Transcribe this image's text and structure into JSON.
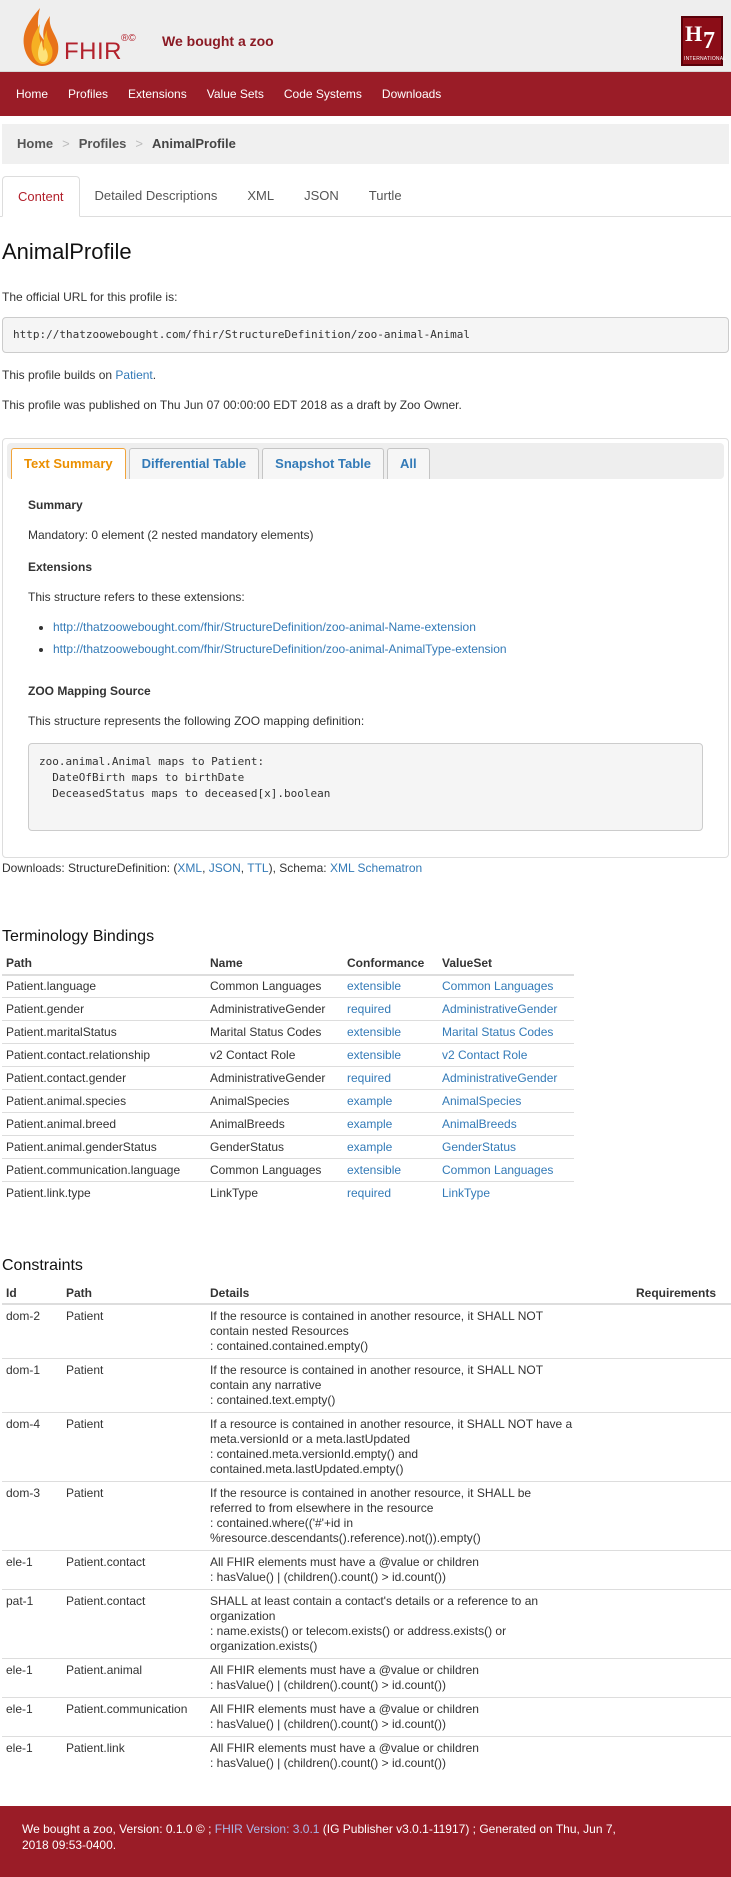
{
  "header": {
    "fhir_text": "FHIR",
    "fhir_mark": "®©",
    "site_title": "We bought a zoo",
    "hl7_letters_h": "H",
    "hl7_letters_7": "7",
    "hl7_intl": "INTERNATIONAL"
  },
  "nav": [
    "Home",
    "Profiles",
    "Extensions",
    "Value Sets",
    "Code Systems",
    "Downloads"
  ],
  "breadcrumb": {
    "home": "Home",
    "profiles": "Profiles",
    "current": "AnimalProfile",
    "separator": ">"
  },
  "top_tabs": [
    "Content",
    "Detailed Descriptions",
    "XML",
    "JSON",
    "Turtle"
  ],
  "content": {
    "title": "AnimalProfile",
    "url_intro": "The official URL for this profile is:",
    "url": "http://thatzoowebought.com/fhir/StructureDefinition/zoo-animal-Animal",
    "builds_on_pre": "This profile builds on ",
    "builds_on_link": "Patient",
    "builds_on_post": ".",
    "published": "This profile was published on Thu Jun 07 00:00:00 EDT 2018 as a draft by Zoo Owner."
  },
  "summary_tabs": [
    "Text Summary",
    "Differential Table",
    "Snapshot Table",
    "All"
  ],
  "summary": {
    "summary_heading": "Summary",
    "mandatory": "Mandatory: 0 element (2 nested mandatory elements)",
    "extensions_heading": "Extensions",
    "extensions_intro": "This structure refers to these extensions:",
    "extensions": [
      "http://thatzoowebought.com/fhir/StructureDefinition/zoo-animal-Name-extension",
      "http://thatzoowebought.com/fhir/StructureDefinition/zoo-animal-AnimalType-extension"
    ],
    "mapping_heading": "ZOO Mapping Source",
    "mapping_intro": "This structure represents the following ZOO mapping definition:",
    "mapping_code": "zoo.animal.Animal maps to Patient:\n  DateOfBirth maps to birthDate\n  DeceasedStatus maps to deceased[x].boolean"
  },
  "downloads": {
    "prefix": "Downloads: StructureDefinition: (",
    "xml": "XML",
    "sep1": ", ",
    "json": "JSON",
    "sep2": ", ",
    "ttl": "TTL",
    "mid": "), Schema: ",
    "schematron": "XML Schematron"
  },
  "terminology": {
    "heading": "Terminology Bindings",
    "columns": [
      "Path",
      "Name",
      "Conformance",
      "ValueSet"
    ],
    "rows": [
      [
        "Patient.language",
        "Common Languages",
        "extensible",
        "Common Languages"
      ],
      [
        "Patient.gender",
        "AdministrativeGender",
        "required",
        "AdministrativeGender"
      ],
      [
        "Patient.maritalStatus",
        "Marital Status Codes",
        "extensible",
        "Marital Status Codes"
      ],
      [
        "Patient.contact.relationship",
        "v2 Contact Role",
        "extensible",
        "v2 Contact Role"
      ],
      [
        "Patient.contact.gender",
        "AdministrativeGender",
        "required",
        "AdministrativeGender"
      ],
      [
        "Patient.animal.species",
        "AnimalSpecies",
        "example",
        "AnimalSpecies"
      ],
      [
        "Patient.animal.breed",
        "AnimalBreeds",
        "example",
        "AnimalBreeds"
      ],
      [
        "Patient.animal.genderStatus",
        "GenderStatus",
        "example",
        "GenderStatus"
      ],
      [
        "Patient.communication.language",
        "Common Languages",
        "extensible",
        "Common Languages"
      ],
      [
        "Patient.link.type",
        "LinkType",
        "required",
        "LinkType"
      ]
    ]
  },
  "constraints": {
    "heading": "Constraints",
    "columns": [
      "Id",
      "Path",
      "Details",
      "Requirements"
    ],
    "rows": [
      {
        "id": "dom-2",
        "path": "Patient",
        "details": [
          "If the resource is contained in another resource, it SHALL NOT",
          "contain nested Resources",
          ": contained.contained.empty()"
        ],
        "req": ""
      },
      {
        "id": "dom-1",
        "path": "Patient",
        "details": [
          "If the resource is contained in another resource, it SHALL NOT",
          "contain any narrative",
          ": contained.text.empty()"
        ],
        "req": ""
      },
      {
        "id": "dom-4",
        "path": "Patient",
        "details": [
          "If a resource is contained in another resource, it SHALL NOT have a",
          "meta.versionId or a meta.lastUpdated",
          ": contained.meta.versionId.empty() and",
          "contained.meta.lastUpdated.empty()"
        ],
        "req": ""
      },
      {
        "id": "dom-3",
        "path": "Patient",
        "details": [
          "If the resource is contained in another resource, it SHALL be",
          "referred to from elsewhere in the resource",
          ": contained.where(('#'+id in",
          "%resource.descendants().reference).not()).empty()"
        ],
        "req": ""
      },
      {
        "id": "ele-1",
        "path": "Patient.contact",
        "details": [
          "All FHIR elements must have a @value or children",
          ": hasValue() | (children().count() > id.count())"
        ],
        "req": ""
      },
      {
        "id": "pat-1",
        "path": "Patient.contact",
        "details": [
          "SHALL at least contain a contact's details or a reference to an",
          "organization",
          ": name.exists() or telecom.exists() or address.exists() or",
          "organization.exists()"
        ],
        "req": ""
      },
      {
        "id": "ele-1",
        "path": "Patient.animal",
        "details": [
          "All FHIR elements must have a @value or children",
          ": hasValue() | (children().count() > id.count())"
        ],
        "req": ""
      },
      {
        "id": "ele-1",
        "path": "Patient.communication",
        "details": [
          "All FHIR elements must have a @value or children",
          ": hasValue() | (children().count() > id.count())"
        ],
        "req": ""
      },
      {
        "id": "ele-1",
        "path": "Patient.link",
        "details": [
          "All FHIR elements must have a @value or children",
          ": hasValue() | (children().count() > id.count())"
        ],
        "req": ""
      }
    ]
  },
  "footer": {
    "prefix": "We bought a zoo, Version: 0.1.0 © ; ",
    "fhir_link": "FHIR Version: 3.0.1",
    "suffix": " (IG Publisher v3.0.1-11917) ; Generated on Thu, Jun 7,",
    "line2": "2018 09:53-0400."
  },
  "colors": {
    "brand_red": "#9a1c27",
    "link_blue": "#337ab7",
    "active_tab_orange": "#eb8f00"
  }
}
